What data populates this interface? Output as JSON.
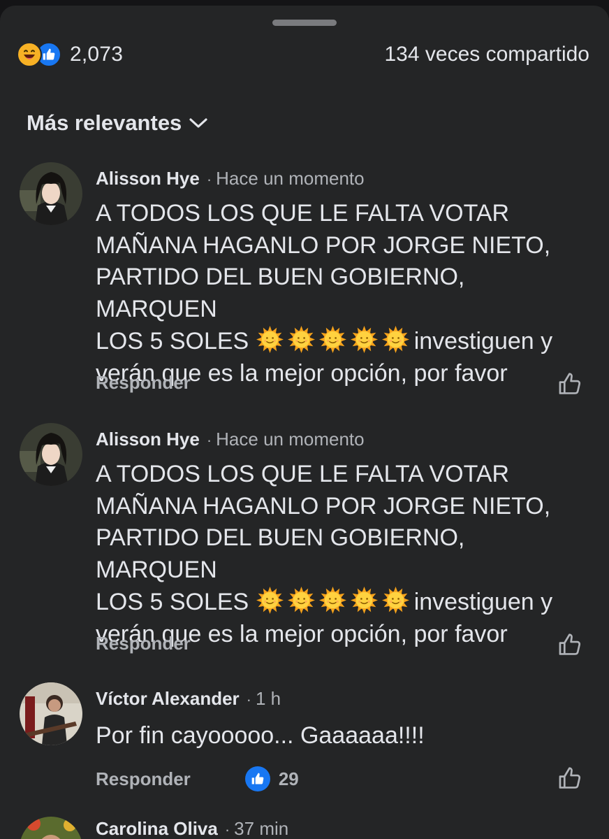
{
  "post_stats": {
    "reaction_count": "2,073",
    "shares": "134 veces compartido",
    "reaction_icons": [
      "haha-icon",
      "like-icon"
    ]
  },
  "sort": {
    "label": "Más relevantes",
    "icon": "chevron-down-icon"
  },
  "comments": [
    {
      "author": "Alisson Hye",
      "time": "Hace un momento",
      "text_line1": "A TODOS LOS QUE LE FALTA VOTAR",
      "text_line2": "MAÑANA HAGANLO POR JORGE NIETO,",
      "text_line3": "PARTIDO DEL BUEN GOBIERNO, MARQUEN",
      "text_line4_start": "LOS 5 SOLES",
      "text_line4_end": "investiguen y",
      "text_line5": "verán que es la mejor opción, por favor",
      "emoji": "sun-with-face",
      "emoji_count": 5,
      "reply_label": "Responder"
    },
    {
      "author": "Alisson Hye",
      "time": "Hace un momento",
      "text_line1": "A TODOS LOS QUE LE FALTA VOTAR",
      "text_line2": "MAÑANA HAGANLO POR JORGE NIETO,",
      "text_line3": "PARTIDO DEL BUEN GOBIERNO, MARQUEN",
      "text_line4_start": "LOS 5 SOLES",
      "text_line4_end": "investiguen y",
      "text_line5": "verán que es la mejor opción, por favor",
      "emoji": "sun-with-face",
      "emoji_count": 5,
      "reply_label": "Responder"
    },
    {
      "author": "Víctor Alexander",
      "time": "1 h",
      "text": "Por fin cayooooo... Gaaaaaa!!!!",
      "reply_label": "Responder",
      "like_count": "29"
    },
    {
      "author": "Carolina Oliva",
      "time": "37 min"
    }
  ],
  "colors": {
    "sheet_bg": "#242526",
    "text_primary": "#e4e6eb",
    "text_secondary": "#b0b3b8",
    "like_blue": "#1877f2",
    "haha_yellow": "#f7b125"
  }
}
